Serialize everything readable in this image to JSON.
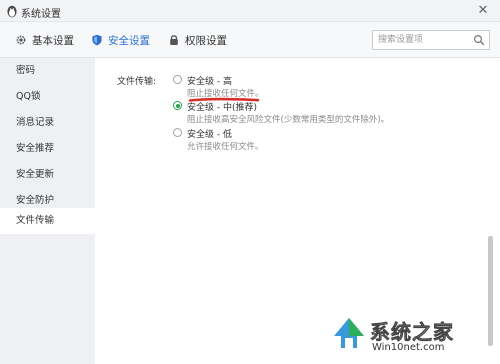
{
  "window": {
    "title": "系统设置",
    "close_glyph": "✕"
  },
  "tabs": [
    {
      "label": "基本设置",
      "icon": "gear-icon"
    },
    {
      "label": "安全设置",
      "icon": "shield-icon",
      "active": true
    },
    {
      "label": "权限设置",
      "icon": "lock-icon"
    }
  ],
  "search": {
    "placeholder": "搜索设置项",
    "value": ""
  },
  "sidebar": {
    "items": [
      {
        "label": "密码"
      },
      {
        "label": "QQ锁"
      },
      {
        "label": "消息记录"
      },
      {
        "label": "安全推荐"
      },
      {
        "label": "安全更新"
      },
      {
        "label": "安全防护"
      },
      {
        "label": "文件传输",
        "active": true
      }
    ]
  },
  "file_transfer": {
    "label": "文件传输:",
    "options": [
      {
        "title": "安全级 - 高",
        "desc": "阻止接收任何文件。",
        "checked": false
      },
      {
        "title": "安全级 - 中(推荐)",
        "desc": "阻止接收高安全风险文件(少数常用类型的文件除外)。",
        "checked": true
      },
      {
        "title": "安全级 - 低",
        "desc": "允许接收任何文件。",
        "checked": false
      }
    ]
  },
  "watermark": {
    "title": "系统之家",
    "url": "Win10net.com"
  },
  "colors": {
    "accent": "#2d6fd0",
    "radio_checked": "#2aa14a",
    "annotation": "#d9302c"
  }
}
